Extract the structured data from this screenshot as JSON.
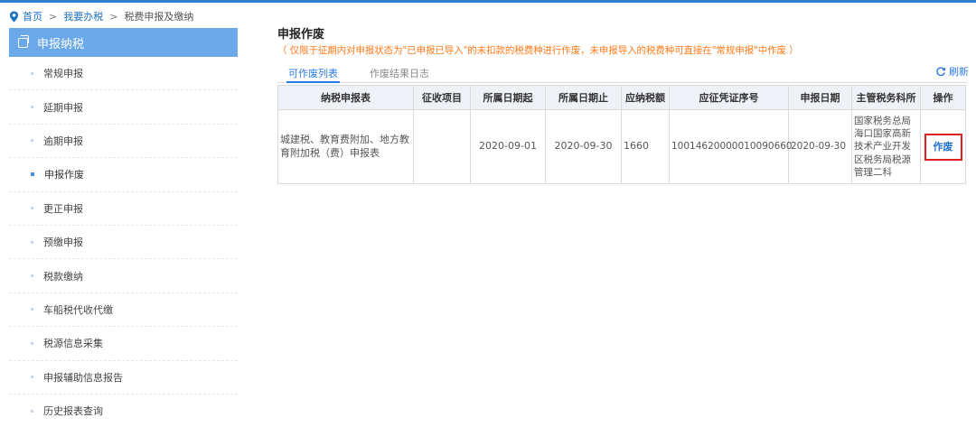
{
  "breadcrumb": {
    "items": [
      "首页",
      "我要办税",
      "税费申报及缴纳"
    ],
    "separator": ">"
  },
  "sidebar": {
    "title": "申报纳税",
    "items": [
      {
        "label": "常规申报"
      },
      {
        "label": "延期申报"
      },
      {
        "label": "逾期申报"
      },
      {
        "label": "申报作废",
        "active": true
      },
      {
        "label": "更正申报"
      },
      {
        "label": "预缴申报"
      },
      {
        "label": "税款缴纳"
      },
      {
        "label": "车船税代收代缴"
      },
      {
        "label": "税源信息采集"
      },
      {
        "label": "申报辅助信息报告"
      },
      {
        "label": "历史报表查询"
      }
    ]
  },
  "main": {
    "title": "申报作废",
    "note": "（ 仅限于征期内对申报状态为\"已申报已导入\"的未扣款的税费种进行作废，未申报导入的税费种可直接在\"常规申报\"中作废 ）",
    "tabs": [
      {
        "label": "可作废列表",
        "active": true
      },
      {
        "label": "作废结果日志",
        "active": false
      }
    ],
    "refresh_label": "刷新"
  },
  "table": {
    "headers": [
      "纳税申报表",
      "征收项目",
      "所属日期起",
      "所属日期止",
      "应纳税额",
      "应征凭证序号",
      "申报日期",
      "主管税务科所",
      "操作"
    ],
    "rows": [
      {
        "form": "城建税、教育费附加、地方教育附加税（费）申报表",
        "item": "",
        "start": "2020-09-01",
        "end": "2020-09-30",
        "amount": "1660",
        "voucher": "10014620000010090660",
        "date": "2020-09-30",
        "office": "国家税务总局海口国家高新技术产业开发区税务局税源管理二科",
        "action": "作废"
      }
    ]
  },
  "colors": {
    "accent": "#2c7be5",
    "sidebar_header": "#6aa8ea",
    "note": "#ff7a1a",
    "action_border": "#e02020"
  }
}
